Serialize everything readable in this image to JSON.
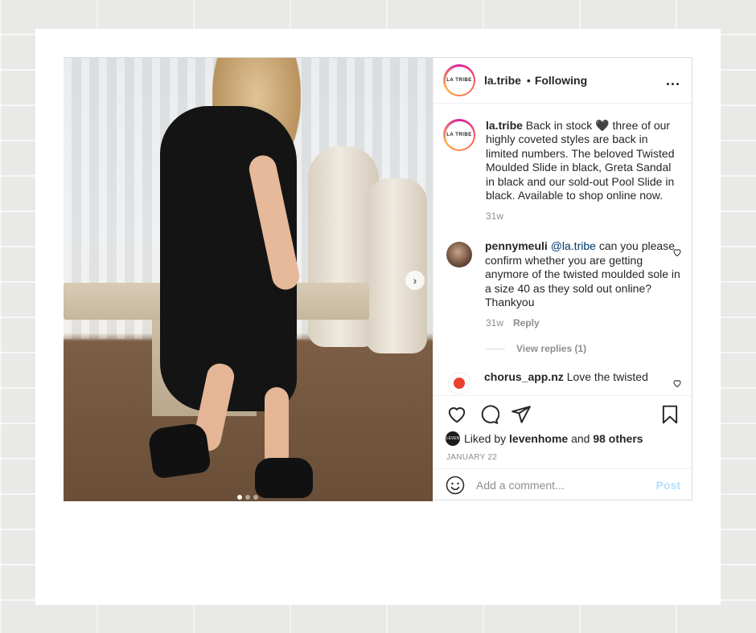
{
  "post": {
    "image_alt_carousel_index": 1,
    "carousel_count": 3
  },
  "header": {
    "avatar_text": "LA TRIBE",
    "username": "la.tribe",
    "separator": "•",
    "following_label": "Following",
    "more_label": "..."
  },
  "caption": {
    "avatar_text": "LA TRIBE",
    "username": "la.tribe",
    "text": "Back in stock 🖤 three of our highly coveted styles are back in limited numbers. The beloved Twisted Moulded Slide in black, Greta Sandal in black and our sold-out Pool Slide in black. Available to shop online now.",
    "time": "31w"
  },
  "comments": [
    {
      "username": "pennymeuli",
      "mention": "@la.tribe",
      "text": "can you please confirm whether you are getting anymore of the twisted moulded sole in a size 40 as they sold out online? Thankyou",
      "time": "31w",
      "reply_label": "Reply",
      "view_replies": "View replies (1)"
    },
    {
      "username": "chorus_app.nz",
      "text": "Love the twisted"
    }
  ],
  "actions": {
    "liker_avatar_text": "LEVEN",
    "liked_by_prefix": "Liked by",
    "liked_by_user": "levenhome",
    "and": "and",
    "others": "98 others",
    "date": "JANUARY 22"
  },
  "add_comment": {
    "placeholder": "Add a comment...",
    "post_label": "Post"
  },
  "colors": {
    "link": "#00376b",
    "muted": "#8e8e8e",
    "post_button_disabled": "#b2dffc"
  }
}
